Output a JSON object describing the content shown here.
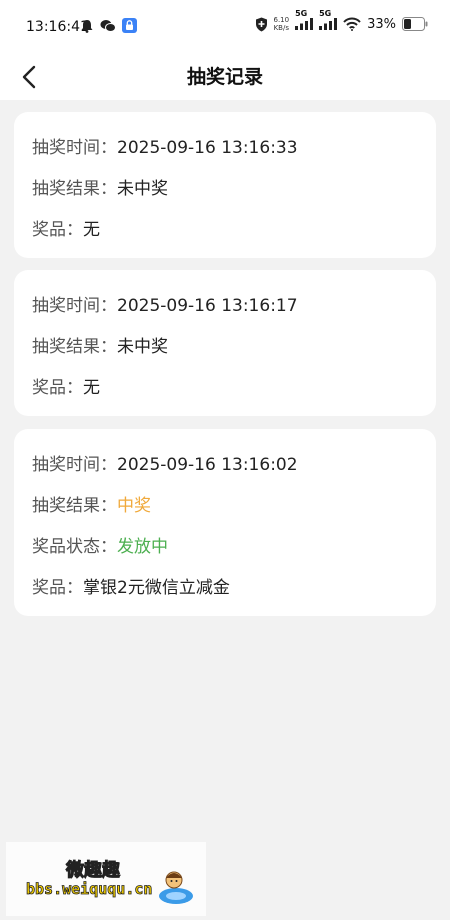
{
  "status_bar": {
    "time": "13:16:41",
    "net_speed_value": "6.10",
    "net_speed_unit": "KB/s",
    "sim1": "5G",
    "sim2": "5G",
    "battery": "33%"
  },
  "header": {
    "title": "抽奖记录"
  },
  "records": [
    {
      "time_label": "抽奖时间：",
      "time_value": "2025-09-16 13:16:33",
      "result_label": "抽奖结果：",
      "result_value": "未中奖",
      "prize_label": "奖品：",
      "prize_value": "无"
    },
    {
      "time_label": "抽奖时间：",
      "time_value": "2025-09-16 13:16:17",
      "result_label": "抽奖结果：",
      "result_value": "未中奖",
      "prize_label": "奖品：",
      "prize_value": "无"
    },
    {
      "time_label": "抽奖时间：",
      "time_value": "2025-09-16 13:16:02",
      "result_label": "抽奖结果：",
      "result_value": "中奖",
      "status_label": "奖品状态：",
      "status_value": "发放中",
      "prize_label": "奖品：",
      "prize_value": "掌银2元微信立减金"
    }
  ],
  "watermark": {
    "title": "微趣趣",
    "url": "bbs.weiququ.cn"
  },
  "colors": {
    "win": "#f0a93b",
    "status_green": "#4caf50"
  }
}
